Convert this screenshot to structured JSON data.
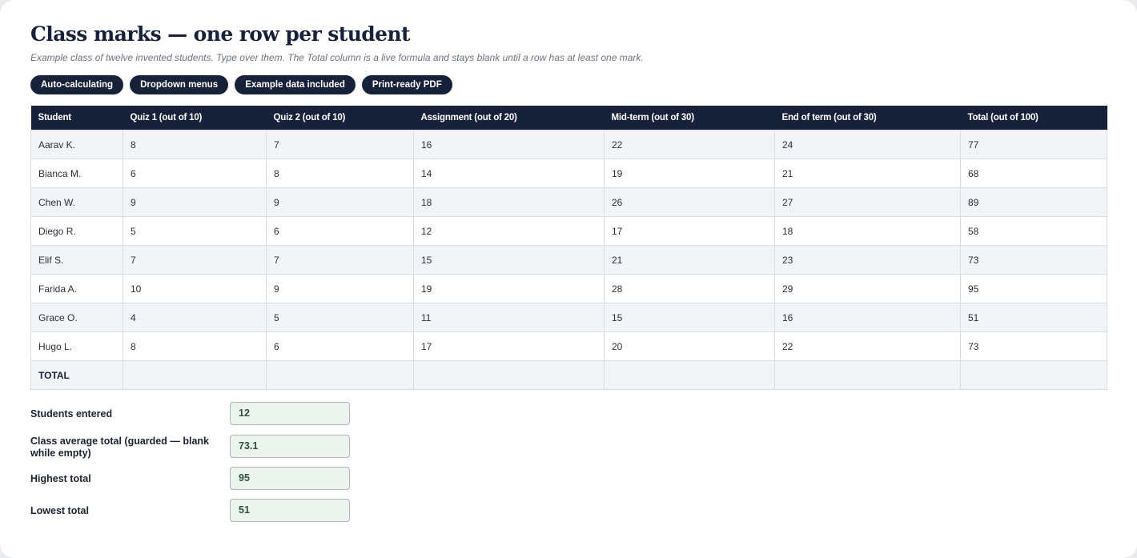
{
  "page": {
    "title": "Class marks — one row per student",
    "subtitle": "Example class of twelve invented students. Type over them. The Total column is a live formula and stays blank until a row has at least one mark."
  },
  "chips": [
    "Auto-calculating",
    "Dropdown menus",
    "Example data included",
    "Print-ready PDF"
  ],
  "table": {
    "headers": [
      "Student",
      "Quiz 1 (out of 10)",
      "Quiz 2 (out of 10)",
      "Assignment (out of 20)",
      "Mid-term (out of 30)",
      "End of term (out of 30)",
      "Total (out of 100)"
    ],
    "rows": [
      [
        "Aarav K.",
        "8",
        "7",
        "16",
        "22",
        "24",
        "77"
      ],
      [
        "Bianca M.",
        "6",
        "8",
        "14",
        "19",
        "21",
        "68"
      ],
      [
        "Chen W.",
        "9",
        "9",
        "18",
        "26",
        "27",
        "89"
      ],
      [
        "Diego R.",
        "5",
        "6",
        "12",
        "17",
        "18",
        "58"
      ],
      [
        "Elif S.",
        "7",
        "7",
        "15",
        "21",
        "23",
        "73"
      ],
      [
        "Farida A.",
        "10",
        "9",
        "19",
        "28",
        "29",
        "95"
      ],
      [
        "Grace O.",
        "4",
        "5",
        "11",
        "15",
        "16",
        "51"
      ],
      [
        "Hugo L.",
        "8",
        "6",
        "17",
        "20",
        "22",
        "73"
      ]
    ],
    "total_label": "TOTAL"
  },
  "summary": {
    "students_entered": {
      "label": "Students entered",
      "value": "12"
    },
    "class_average": {
      "label": "Class average total (guarded — blank while empty)",
      "value": "73.1"
    },
    "highest": {
      "label": "Highest total",
      "value": "95"
    },
    "lowest": {
      "label": "Lowest total",
      "value": "51"
    }
  },
  "colors": {
    "header_bg": "#17223a",
    "chip_bg": "#17223a",
    "summary_box_bg": "#ecf3ee",
    "summary_text": "#2d5242"
  }
}
